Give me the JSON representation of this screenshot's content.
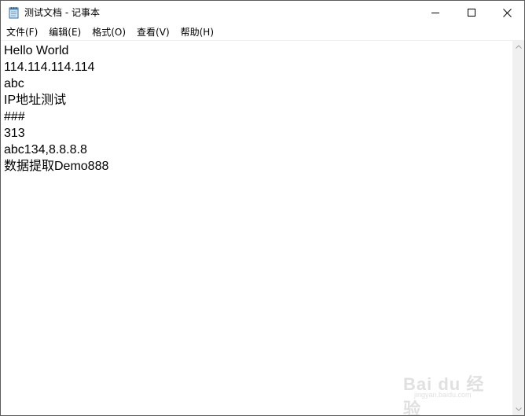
{
  "window": {
    "title": "测试文档 - 记事本"
  },
  "menu": [
    {
      "label": "文件(F)"
    },
    {
      "label": "编辑(E)"
    },
    {
      "label": "格式(O)"
    },
    {
      "label": "查看(V)"
    },
    {
      "label": "帮助(H)"
    }
  ],
  "editor": {
    "lines": [
      "Hello World",
      "114.114.114.114",
      "abc",
      "IP地址测试",
      "###",
      "313",
      "abc134,8.8.8.8",
      "数据提取Demo888"
    ]
  },
  "watermark": {
    "brand": "Bai du 经验",
    "site": "jingyan.baidu.com"
  },
  "icons": {
    "app": "notepad-icon",
    "minimize": "minimize-icon",
    "maximize": "maximize-icon",
    "close": "close-icon"
  }
}
